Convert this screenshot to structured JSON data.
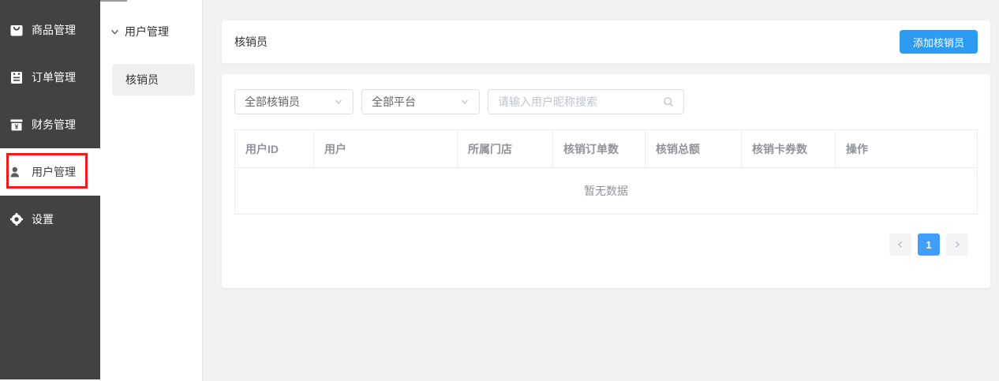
{
  "colors": {
    "accent_blue": "#2d9cf0",
    "pager_active_blue": "#409eff",
    "sidebar_bg": "#424242",
    "annotation_red": "#f01b1b",
    "main_bg": "#f2f2f2"
  },
  "sidebar": {
    "items": [
      {
        "label": "商品管理",
        "icon": "bag-icon"
      },
      {
        "label": "订单管理",
        "icon": "order-icon"
      },
      {
        "label": "财务管理",
        "icon": "finance-icon"
      },
      {
        "label": "用户管理",
        "icon": "user-icon",
        "active": true
      },
      {
        "label": "设置",
        "icon": "gear-icon"
      }
    ]
  },
  "submenu": {
    "group_label": "用户管理",
    "items": [
      {
        "label": "核销员",
        "active": true
      }
    ]
  },
  "page": {
    "title": "核销员",
    "add_button_label": "添加核销员"
  },
  "filters": {
    "reviewer_select_value": "全部核销员",
    "platform_select_value": "全部平台",
    "search_placeholder": "请输入用户昵称搜索"
  },
  "table": {
    "columns": [
      "用户ID",
      "用户",
      "所属门店",
      "核销订单数",
      "核销总额",
      "核销卡券数",
      "操作"
    ],
    "rows": [],
    "empty_text": "暂无数据"
  },
  "pagination": {
    "current_page": "1"
  }
}
